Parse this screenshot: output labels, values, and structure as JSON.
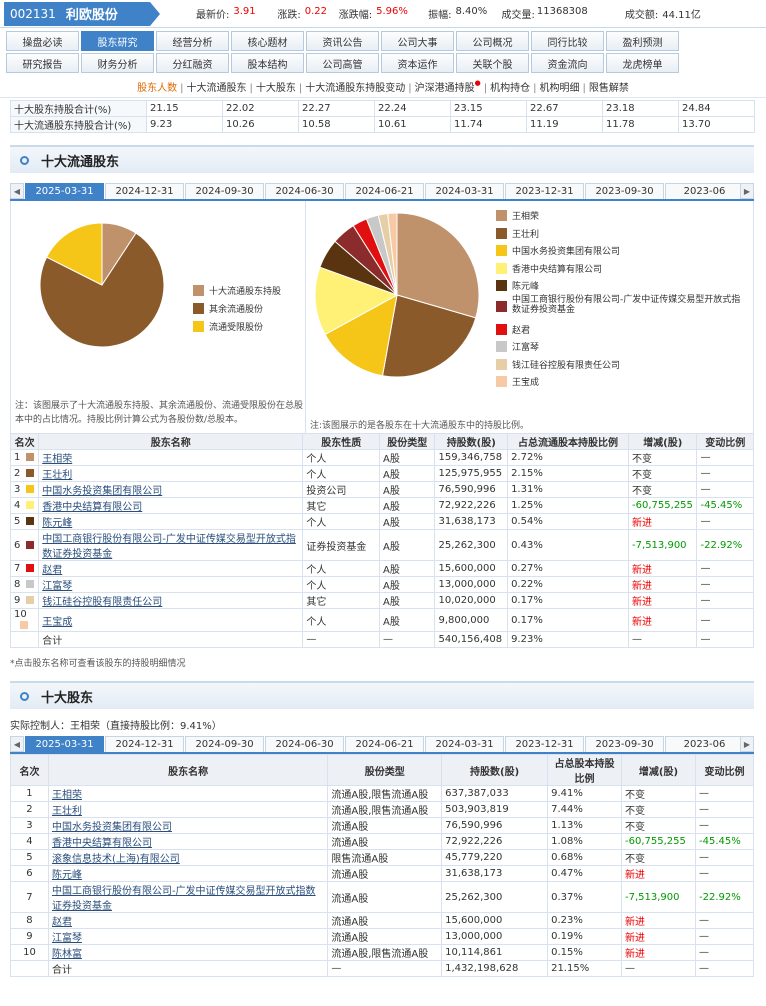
{
  "stock": {
    "code": "002131",
    "name": "利欧股份"
  },
  "quote": {
    "price_label": "最新价:",
    "price": "3.91",
    "change_label": "涨跌:",
    "change": "0.22",
    "pct_label": "涨跌幅:",
    "pct": "5.96%",
    "amp_label": "振幅:",
    "amp": "8.40%",
    "vol_label": "成交量:",
    "vol": "11368308",
    "amt_label": "成交额:",
    "amt": "44.11亿"
  },
  "tabs_row1": [
    "操盘必读",
    "股东研究",
    "经营分析",
    "核心题材",
    "资讯公告",
    "公司大事",
    "公司概况",
    "同行比较",
    "盈利预测"
  ],
  "tabs_row2": [
    "研究报告",
    "财务分析",
    "分红融资",
    "股本结构",
    "公司高管",
    "资本运作",
    "关联个股",
    "资金流向",
    "龙虎榜单"
  ],
  "active_tab": "股东研究",
  "subnav": [
    "股东人数",
    "十大流通股东",
    "十大股东",
    "十大流通股东持股变动",
    "沪深港通持股",
    "机构持仓",
    "机构明细",
    "限售解禁"
  ],
  "summary": [
    {
      "label": "十大股东持股合计(%)",
      "values": [
        "21.15",
        "22.02",
        "22.27",
        "22.24",
        "23.15",
        "22.67",
        "23.18",
        "24.84"
      ]
    },
    {
      "label": "十大流通股东持股合计(%)",
      "values": [
        "9.23",
        "10.26",
        "10.58",
        "10.61",
        "11.74",
        "11.19",
        "11.78",
        "13.70"
      ]
    }
  ],
  "section1": {
    "title": "十大流通股东"
  },
  "section2": {
    "title": "十大股东",
    "controller": "实际控制人：王相荣（直接持股比例：9.41%）"
  },
  "dates": [
    "2025-03-31",
    "2024-12-31",
    "2024-09-30",
    "2024-06-30",
    "2024-06-21",
    "2024-03-31",
    "2023-12-31",
    "2023-09-30",
    "2023-06"
  ],
  "pieL_legend": [
    {
      "label": "十大流通股东持股",
      "color": "#c0926b"
    },
    {
      "label": "其余流通股份",
      "color": "#8a5a2b"
    },
    {
      "label": "流通受限股份",
      "color": "#f5c518"
    }
  ],
  "pieL_note": "注：该图展示了十大流通股东持股、其余流通股份、流通受限股份在总股本中的占比情况。持股比例计算公式为各股份数/总股本。",
  "pieR_note": "注:该图展示的是各股东在十大流通股东中的持股比例。",
  "chart_data": [
    {
      "type": "pie",
      "categories": [
        "十大流通股东持股",
        "其余流通股份",
        "流通受限股份"
      ],
      "values": [
        9.23,
        73.2,
        17.57
      ],
      "colors": [
        "#c0926b",
        "#8a5a2b",
        "#f5c518"
      ]
    },
    {
      "type": "pie",
      "categories": [
        "王相荣",
        "王壮利",
        "中国水务投资集团有限公司",
        "香港中央结算有限公司",
        "陈元峰",
        "中国工商银行股份有限公司-广发中证传媒交易型开放式指数证券投资基金",
        "赵君",
        "江富琴",
        "钱江硅谷控股有限责任公司",
        "王宝成"
      ],
      "values": [
        159346758,
        125975955,
        76590996,
        72922226,
        31638173,
        25262300,
        15600000,
        13000000,
        10020000,
        9800000
      ],
      "colors": [
        "#c0926b",
        "#8a5a2b",
        "#f5c518",
        "#fff176",
        "#5a3410",
        "#8b2b2b",
        "#e01010",
        "#c8c8c8",
        "#e6cfa6",
        "#f7c9a5"
      ]
    }
  ],
  "t1_headers": [
    "名次",
    "股东名称",
    "股东性质",
    "股份类型",
    "持股数(股)",
    "占总流通股本持股比例",
    "增减(股)",
    "变动比例"
  ],
  "t1_rows": [
    {
      "rank": "1",
      "name": "王相荣",
      "nature": "个人",
      "type": "A股",
      "shares": "159,346,758",
      "ratio": "2.72%",
      "chg": "不变",
      "chg_c": "",
      "pct": "—",
      "pct_c": "",
      "color": "#c0926b"
    },
    {
      "rank": "2",
      "name": "王壮利",
      "nature": "个人",
      "type": "A股",
      "shares": "125,975,955",
      "ratio": "2.15%",
      "chg": "不变",
      "chg_c": "",
      "pct": "—",
      "pct_c": "",
      "color": "#8a5a2b"
    },
    {
      "rank": "3",
      "name": "中国水务投资集团有限公司",
      "nature": "投资公司",
      "type": "A股",
      "shares": "76,590,996",
      "ratio": "1.31%",
      "chg": "不变",
      "chg_c": "",
      "pct": "—",
      "pct_c": "",
      "color": "#f5c518"
    },
    {
      "rank": "4",
      "name": "香港中央结算有限公司",
      "nature": "其它",
      "type": "A股",
      "shares": "72,922,226",
      "ratio": "1.25%",
      "chg": "-60,755,255",
      "chg_c": "green",
      "pct": "-45.45%",
      "pct_c": "green",
      "color": "#fff176"
    },
    {
      "rank": "5",
      "name": "陈元峰",
      "nature": "个人",
      "type": "A股",
      "shares": "31,638,173",
      "ratio": "0.54%",
      "chg": "新进",
      "chg_c": "red",
      "pct": "—",
      "pct_c": "",
      "color": "#5a3410"
    },
    {
      "rank": "6",
      "name": "中国工商银行股份有限公司-广发中证传媒交易型开放式指数证券投资基金",
      "nature": "证券投资基金",
      "type": "A股",
      "shares": "25,262,300",
      "ratio": "0.43%",
      "chg": "-7,513,900",
      "chg_c": "green",
      "pct": "-22.92%",
      "pct_c": "green",
      "color": "#8b2b2b"
    },
    {
      "rank": "7",
      "name": "赵君",
      "nature": "个人",
      "type": "A股",
      "shares": "15,600,000",
      "ratio": "0.27%",
      "chg": "新进",
      "chg_c": "red",
      "pct": "—",
      "pct_c": "",
      "color": "#e01010"
    },
    {
      "rank": "8",
      "name": "江富琴",
      "nature": "个人",
      "type": "A股",
      "shares": "13,000,000",
      "ratio": "0.22%",
      "chg": "新进",
      "chg_c": "red",
      "pct": "—",
      "pct_c": "",
      "color": "#c8c8c8"
    },
    {
      "rank": "9",
      "name": "钱江硅谷控股有限责任公司",
      "nature": "其它",
      "type": "A股",
      "shares": "10,020,000",
      "ratio": "0.17%",
      "chg": "新进",
      "chg_c": "red",
      "pct": "—",
      "pct_c": "",
      "color": "#e6cfa6"
    },
    {
      "rank": "10",
      "name": "王宝成",
      "nature": "个人",
      "type": "A股",
      "shares": "9,800,000",
      "ratio": "0.17%",
      "chg": "新进",
      "chg_c": "red",
      "pct": "—",
      "pct_c": "",
      "color": "#f7c9a5"
    }
  ],
  "t1_total": {
    "label": "合计",
    "nature": "—",
    "type": "—",
    "shares": "540,156,408",
    "ratio": "9.23%",
    "chg": "—",
    "pct": "—"
  },
  "t1_footnote": "*点击股东名称可查看该股东的持股明细情况",
  "t2_headers": [
    "名次",
    "股东名称",
    "股份类型",
    "持股数(股)",
    "占总股本持股比例",
    "增减(股)",
    "变动比例"
  ],
  "t2_rows": [
    {
      "rank": "1",
      "name": "王相荣",
      "type": "流通A股,限售流通A股",
      "shares": "637,387,033",
      "ratio": "9.41%",
      "chg": "不变",
      "chg_c": "",
      "pct": "—",
      "pct_c": ""
    },
    {
      "rank": "2",
      "name": "王壮利",
      "type": "流通A股,限售流通A股",
      "shares": "503,903,819",
      "ratio": "7.44%",
      "chg": "不变",
      "chg_c": "",
      "pct": "—",
      "pct_c": ""
    },
    {
      "rank": "3",
      "name": "中国水务投资集团有限公司",
      "type": "流通A股",
      "shares": "76,590,996",
      "ratio": "1.13%",
      "chg": "不变",
      "chg_c": "",
      "pct": "—",
      "pct_c": ""
    },
    {
      "rank": "4",
      "name": "香港中央结算有限公司",
      "type": "流通A股",
      "shares": "72,922,226",
      "ratio": "1.08%",
      "chg": "-60,755,255",
      "chg_c": "green",
      "pct": "-45.45%",
      "pct_c": "green"
    },
    {
      "rank": "5",
      "name": "滚象信息技术(上海)有限公司",
      "type": "限售流通A股",
      "shares": "45,779,220",
      "ratio": "0.68%",
      "chg": "不变",
      "chg_c": "",
      "pct": "—",
      "pct_c": ""
    },
    {
      "rank": "6",
      "name": "陈元峰",
      "type": "流通A股",
      "shares": "31,638,173",
      "ratio": "0.47%",
      "chg": "新进",
      "chg_c": "red",
      "pct": "—",
      "pct_c": ""
    },
    {
      "rank": "7",
      "name": "中国工商银行股份有限公司-广发中证传媒交易型开放式指数证券投资基金",
      "type": "流通A股",
      "shares": "25,262,300",
      "ratio": "0.37%",
      "chg": "-7,513,900",
      "chg_c": "green",
      "pct": "-22.92%",
      "pct_c": "green"
    },
    {
      "rank": "8",
      "name": "赵君",
      "type": "流通A股",
      "shares": "15,600,000",
      "ratio": "0.23%",
      "chg": "新进",
      "chg_c": "red",
      "pct": "—",
      "pct_c": ""
    },
    {
      "rank": "9",
      "name": "江富琴",
      "type": "流通A股",
      "shares": "13,000,000",
      "ratio": "0.19%",
      "chg": "新进",
      "chg_c": "red",
      "pct": "—",
      "pct_c": ""
    },
    {
      "rank": "10",
      "name": "陈林富",
      "type": "流通A股,限售流通A股",
      "shares": "10,114,861",
      "ratio": "0.15%",
      "chg": "新进",
      "chg_c": "red",
      "pct": "—",
      "pct_c": ""
    }
  ],
  "t2_total": {
    "label": "合计",
    "type": "—",
    "shares": "1,432,198,628",
    "ratio": "21.15%",
    "chg": "—",
    "pct": "—"
  }
}
